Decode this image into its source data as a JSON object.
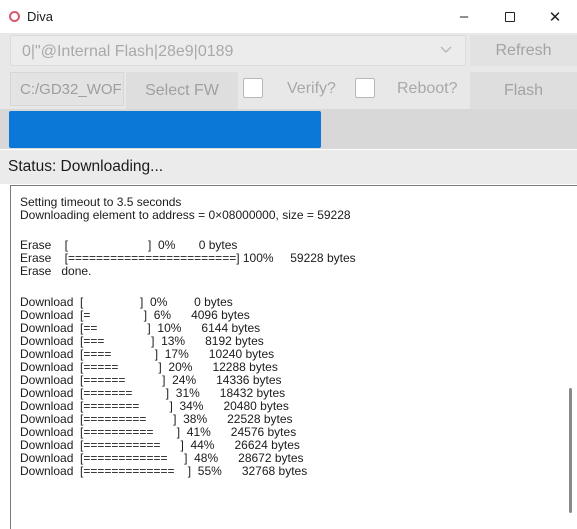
{
  "window": {
    "title": "Diva",
    "minimize_glyph": "–",
    "close_glyph": "✕",
    "icon_color": "#d85a72"
  },
  "toolbar": {
    "device_value": "0|\"@Internal Flash|28e9|0189",
    "refresh_label": "Refresh",
    "path_value": "C:/GD32_WOF",
    "select_fw_label": "Select FW",
    "verify_label": "Verify?",
    "verify_checked": false,
    "reboot_label": "Reboot?",
    "reboot_checked": false,
    "flash_label": "Flash"
  },
  "progress": {
    "fraction": 0.55,
    "color": "#0b78d7"
  },
  "status": {
    "text": "Status: Downloading..."
  },
  "log": {
    "lines": [
      "Setting timeout to 3.5 seconds",
      "Downloading element to address = 0×08000000, size = 59228",
      "Erase    [                        ]  0%       0 bytes",
      "Erase    [========================] 100%     59228 bytes",
      "Erase   done.",
      "Download  [                 ]  0%        0 bytes",
      "Download  [=                ]  6%      4096 bytes",
      "Download  [==               ]  10%      6144 bytes",
      "Download  [===              ]  13%      8192 bytes",
      "Download  [====             ]  17%      10240 bytes",
      "Download  [=====            ]  20%      12288 bytes",
      "Download  [======           ]  24%      14336 bytes",
      "Download  [=======          ]  31%      18432 bytes",
      "Download  [========         ]  34%      20480 bytes",
      "Download  [=========        ]  38%      22528 bytes",
      "Download  [==========       ]  41%      24576 bytes",
      "Download  [===========      ]  44%      26624 bytes",
      "Download  [============     ]  48%      28672 bytes",
      "Download  [=============    ]  55%      32768 bytes"
    ]
  }
}
